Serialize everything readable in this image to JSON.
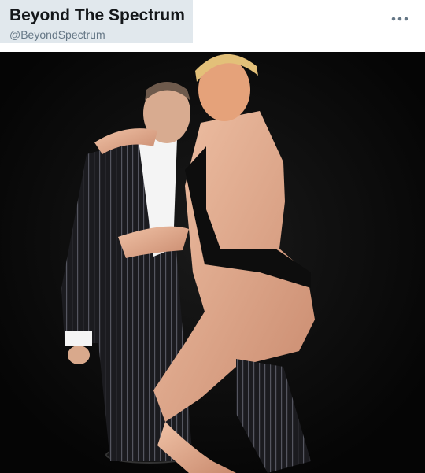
{
  "tweet": {
    "display_name": "Beyond The Spectrum",
    "handle": "@BeyondSpectrum",
    "more_icon": "more-horizontal-icon"
  },
  "media": {
    "type": "photo",
    "icon": "tweet-photo"
  },
  "colors": {
    "name_highlight": "#e1e8ed",
    "name_text": "#14171a",
    "handle_text": "#657786",
    "photo_background": "#080808"
  }
}
